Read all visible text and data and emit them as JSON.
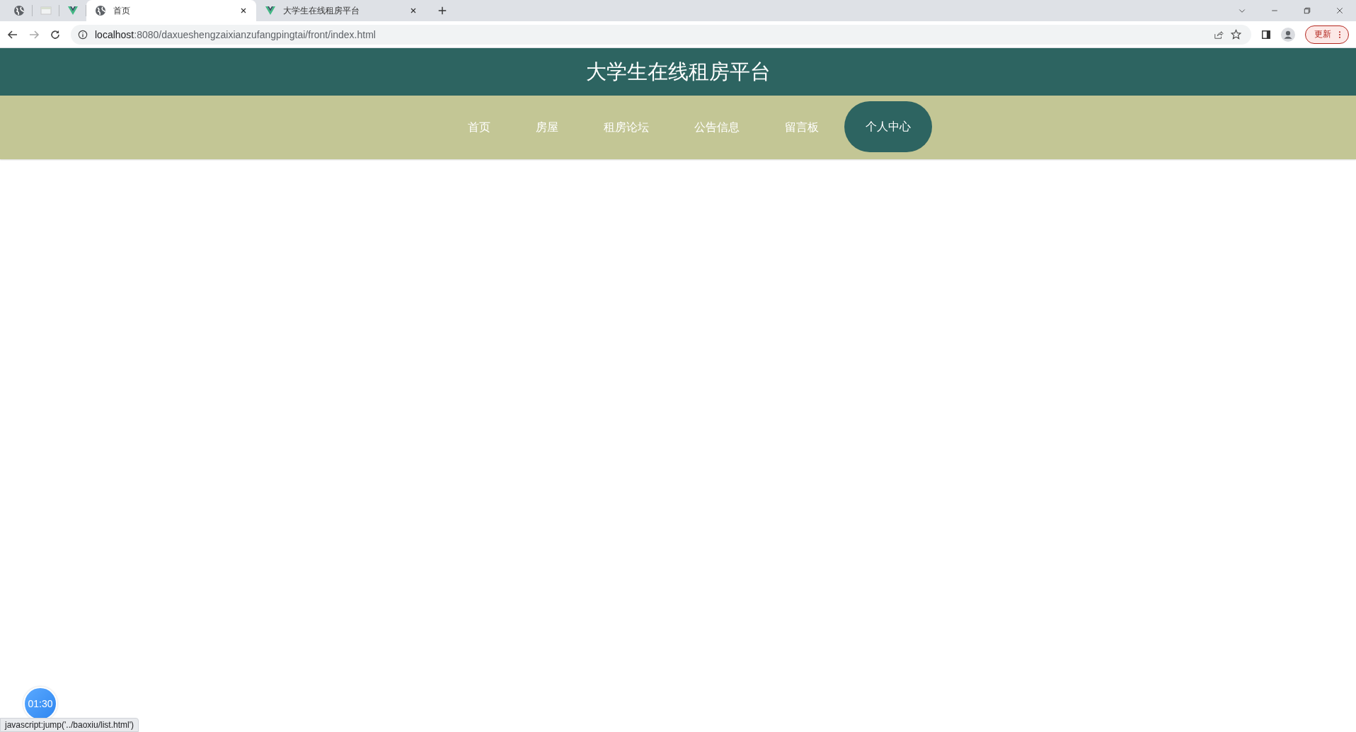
{
  "browser": {
    "tabs": [
      {
        "kind": "pinned",
        "selected": false
      },
      {
        "kind": "pinned",
        "selected": false
      },
      {
        "kind": "pinned",
        "selected": false
      },
      {
        "kind": "page",
        "title": "首页",
        "selected": true
      },
      {
        "kind": "page",
        "title": "大学生在线租房平台",
        "selected": false
      }
    ],
    "url_host": "localhost",
    "url_rest": ":8080/daxueshengzaixianzufangpingtai/front/index.html",
    "update_button": "更新"
  },
  "site": {
    "title": "大学生在线租房平台",
    "nav": [
      {
        "label": "首页",
        "selected": false
      },
      {
        "label": "房屋",
        "selected": false
      },
      {
        "label": "租房论坛",
        "selected": false
      },
      {
        "label": "公告信息",
        "selected": false
      },
      {
        "label": "留言板",
        "selected": false
      },
      {
        "label": "个人中心",
        "selected": true
      }
    ]
  },
  "timer": "01:30",
  "status_url": "javascript:jump('../baoxiu/list.html')"
}
